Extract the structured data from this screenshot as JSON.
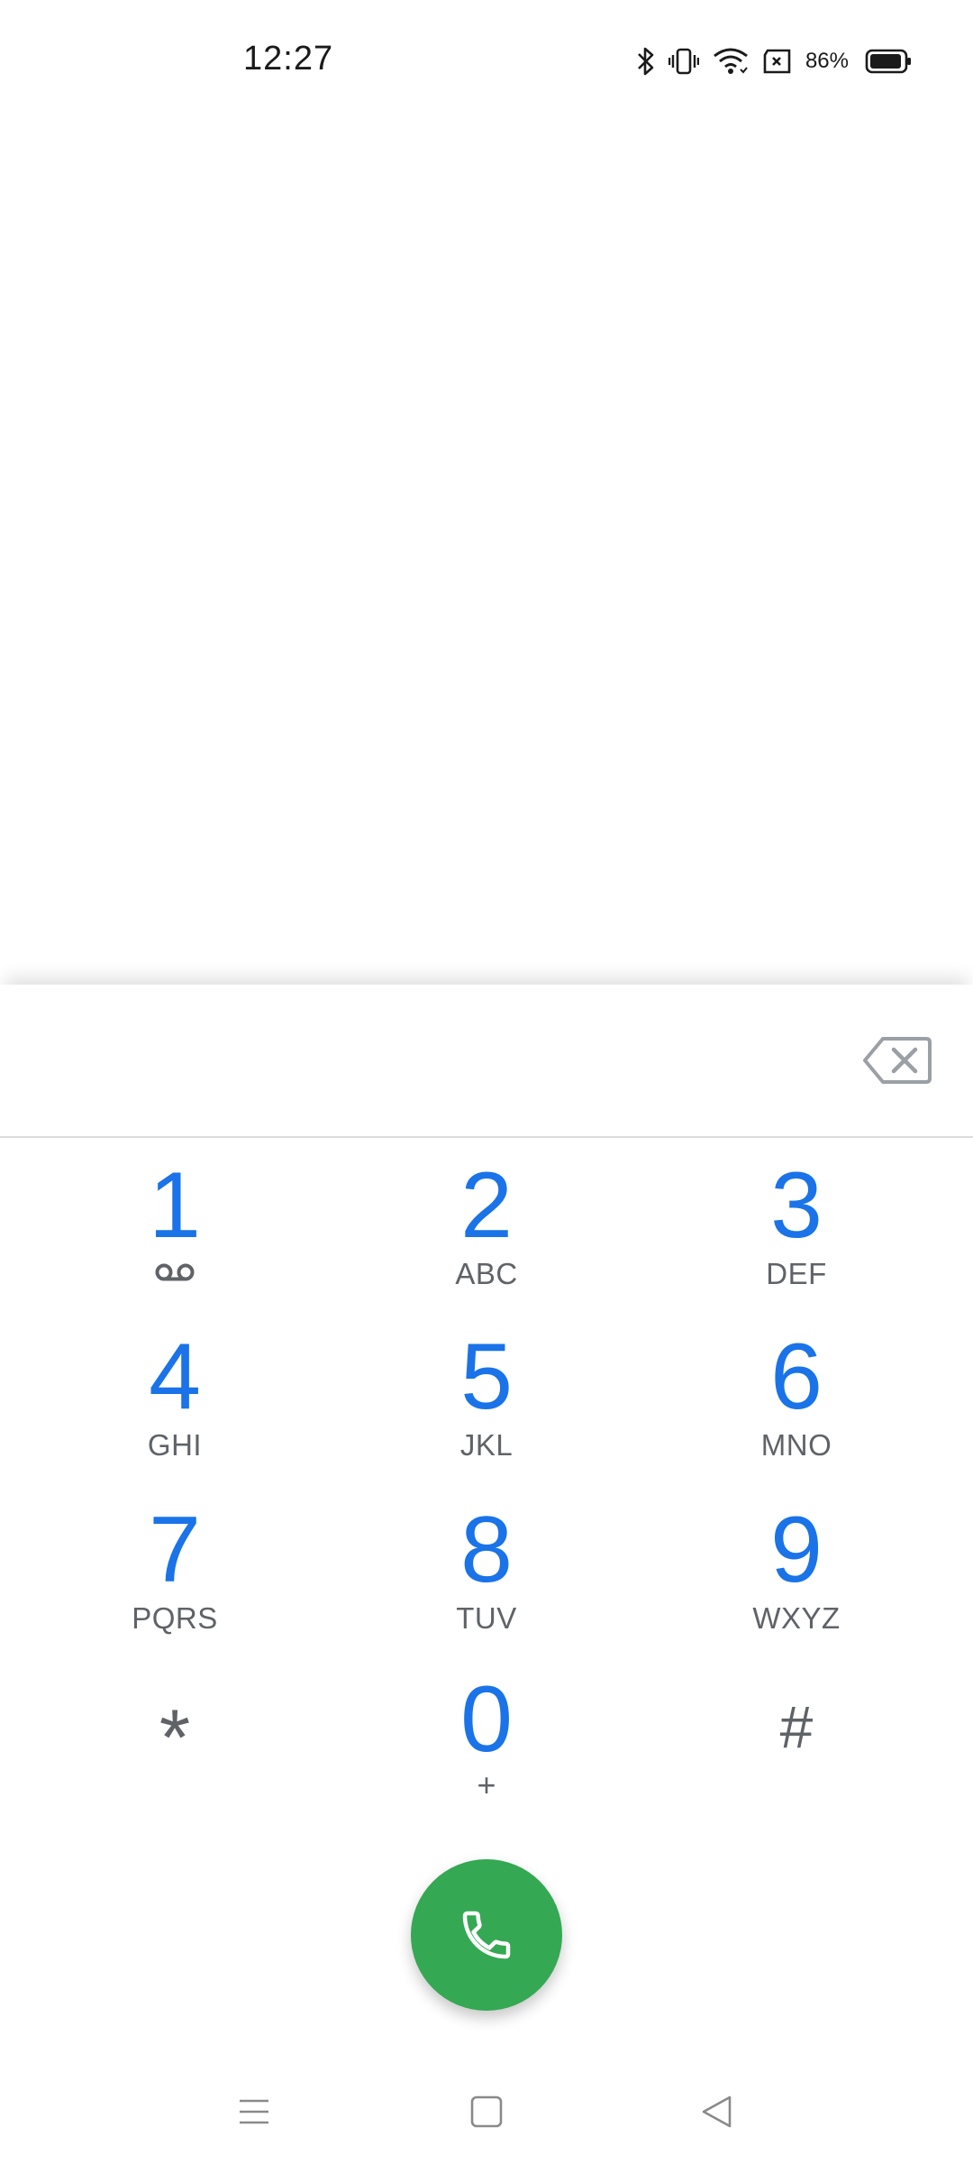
{
  "status_bar": {
    "time": "12:27",
    "battery_percent": "86%",
    "icons": [
      "bluetooth-icon",
      "vibrate-icon",
      "wifi-icon",
      "sim-card-icon",
      "battery-icon"
    ]
  },
  "dialer": {
    "entered_digits": "",
    "keys": [
      {
        "digit": "1",
        "letters": "",
        "sub_icon": "voicemail-icon"
      },
      {
        "digit": "2",
        "letters": "ABC"
      },
      {
        "digit": "3",
        "letters": "DEF"
      },
      {
        "digit": "4",
        "letters": "GHI"
      },
      {
        "digit": "5",
        "letters": "JKL"
      },
      {
        "digit": "6",
        "letters": "MNO"
      },
      {
        "digit": "7",
        "letters": "PQRS"
      },
      {
        "digit": "8",
        "letters": "TUV"
      },
      {
        "digit": "9",
        "letters": "WXYZ"
      },
      {
        "digit": "*",
        "letters": ""
      },
      {
        "digit": "0",
        "letters": "+"
      },
      {
        "digit": "#",
        "letters": ""
      }
    ],
    "call_button_icon": "phone-icon",
    "backspace_icon": "backspace-icon"
  },
  "colors": {
    "digit_blue": "#1a73e8",
    "call_green": "#34a853",
    "letters_gray": "#5f6368"
  },
  "nav_bar": {
    "icons": [
      "menu-icon",
      "home-icon",
      "back-icon"
    ]
  }
}
